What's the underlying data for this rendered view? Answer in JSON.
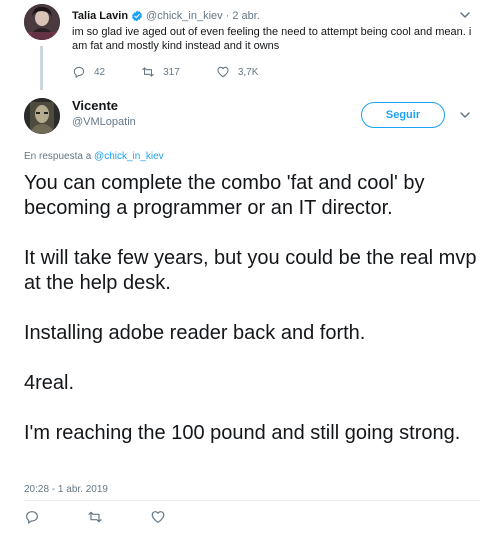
{
  "parent_tweet": {
    "author_name": "Talia Lavin",
    "verified": true,
    "handle": "@chick_in_kiev",
    "separator": "·",
    "date": "2 abr.",
    "text": "im so glad ive aged out of even feeling the need to attempt being cool and mean. i am fat and mostly kind instead and it owns",
    "reply_count": "42",
    "retweet_count": "317",
    "like_count": "3,7K"
  },
  "main_tweet": {
    "author_name": "Vicente",
    "handle": "@VMLopatin",
    "follow_label": "Seguir",
    "reply_prefix": "En respuesta a",
    "reply_mention": "@chick_in_kiev",
    "paragraphs": [
      "You can complete the combo 'fat and cool' by becoming a programmer or an IT director.",
      "It will take few years, but you could be the real mvp at the help desk.",
      "Installing adobe reader back and forth.",
      "4real.",
      "I'm reaching the 100 pound and still going strong."
    ],
    "timestamp": "20:28 - 1 abr. 2019"
  },
  "icons": {
    "reply": "reply-icon",
    "retweet": "retweet-icon",
    "like": "heart-icon",
    "more": "chevron-down-icon",
    "verified": "verified-badge-icon"
  },
  "colors": {
    "accent": "#1da1f2",
    "muted": "#657786",
    "text": "#14171a",
    "divider": "#e6ecf0",
    "thread_line": "#ccd6dd"
  }
}
